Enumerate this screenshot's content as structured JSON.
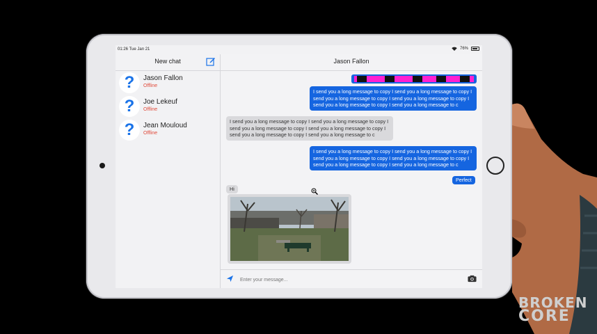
{
  "status_bar": {
    "time": "01:26 Tue Jan 21",
    "battery": "76%"
  },
  "sidebar": {
    "title": "New chat",
    "contacts": [
      {
        "name": "Jason Fallon",
        "status": "Offline"
      },
      {
        "name": "Joe Lekeuf",
        "status": "Offline"
      },
      {
        "name": "Jean Mouloud",
        "status": "Offline"
      }
    ]
  },
  "chat": {
    "title": "Jason Fallon",
    "messages": [
      {
        "direction": "out",
        "text": "I send you a long message to copy I send you a long message to copy I send you a long message to copy I send you a long message to copy I send you a long message to copy I send you a long message to c"
      },
      {
        "direction": "in",
        "text": "I send you a long message to copy I send you a long message to copy I send you a long message to copy I send you a long message to copy I send you a long message to copy I send you a long message to c"
      },
      {
        "direction": "out",
        "text": "I send you a long message to copy I send you a long message to copy I send you a long message to copy I send you a long message to copy I send you a long message to copy I send you a long message to c"
      },
      {
        "direction": "out",
        "text": "Perfect"
      },
      {
        "direction": "in",
        "text": "Hi"
      }
    ],
    "input_placeholder": "Enter your message..."
  },
  "watermark": {
    "line1": "BROKEN",
    "line2": "CORE"
  },
  "colors": {
    "outgoing": "#1565e0",
    "incoming": "#d9d9dc",
    "offline": "#e04a3a"
  }
}
